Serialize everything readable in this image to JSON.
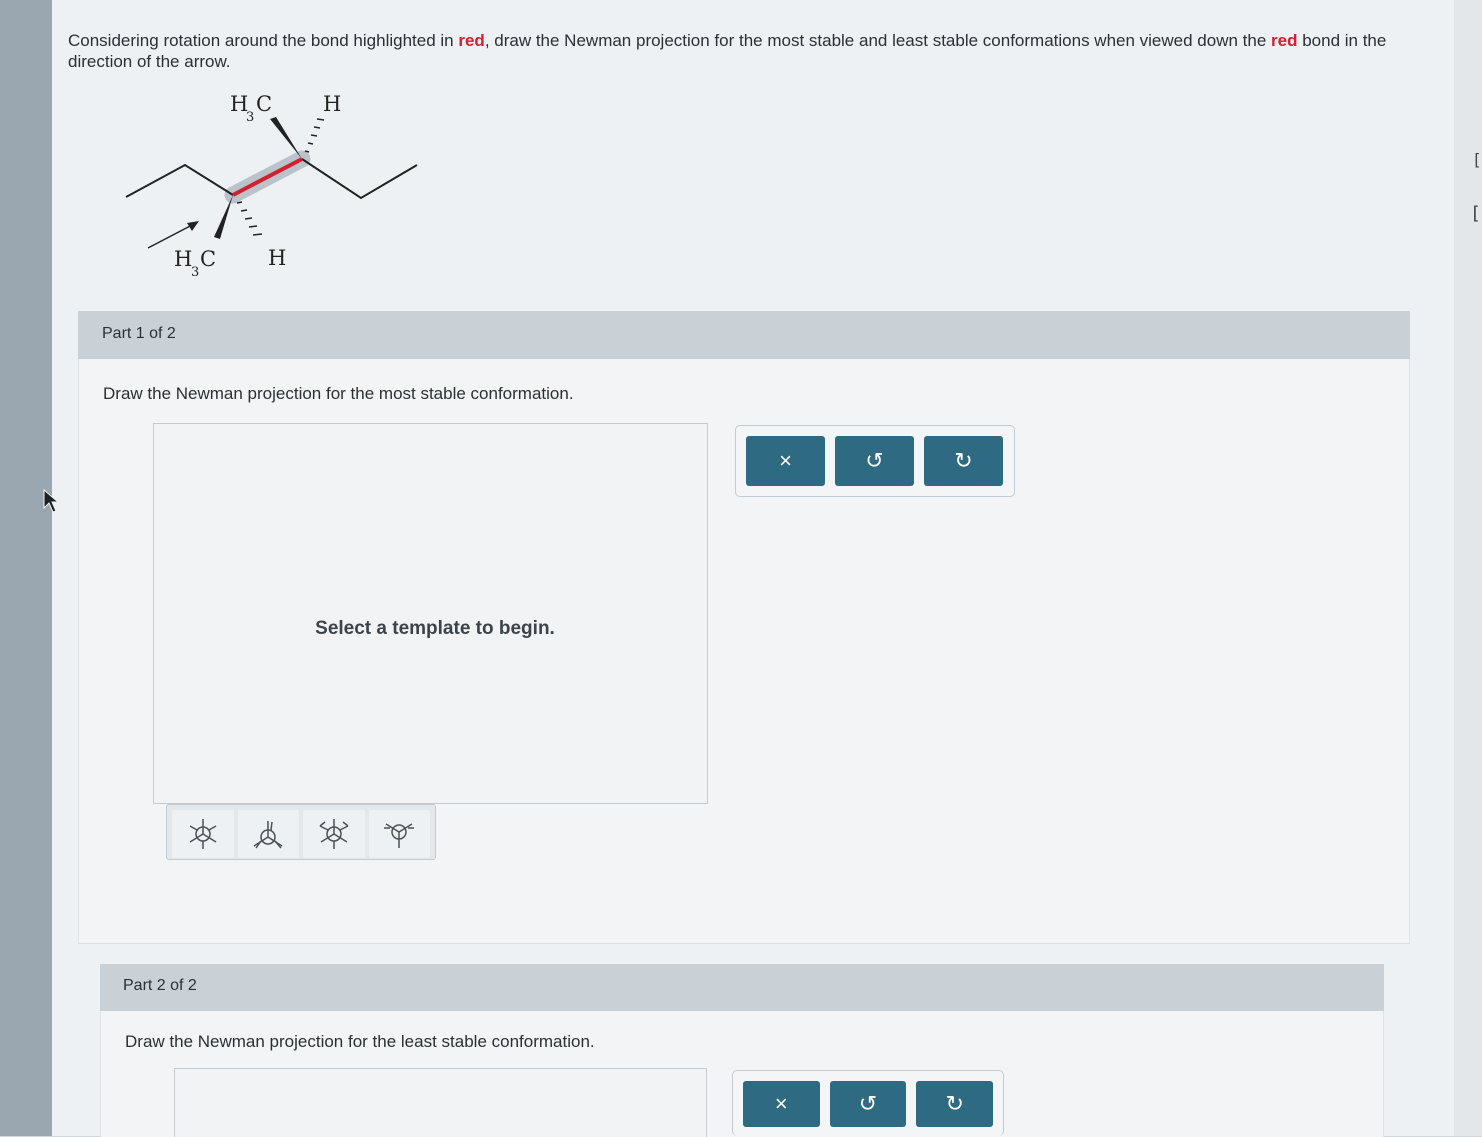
{
  "question": {
    "part1": "Considering rotation around the bond highlighted in ",
    "red1": "red",
    "part2": ", draw the Newman projection for the most stable and least stable conformations when viewed down the ",
    "red2": "red",
    "part3": " bond in the direction of the arrow."
  },
  "molecule": {
    "top_left_label": "H",
    "top_left_sub": "3",
    "top_left_tail": "C",
    "top_right_label": "H",
    "bottom_left_label": "H",
    "bottom_left_sub": "3",
    "bottom_left_tail": "C",
    "bottom_right_label": "H",
    "highlight_color": "#d1202f"
  },
  "part1": {
    "title": "Part 1 of 2",
    "instruction": "Draw the Newman projection for the most stable conformation.",
    "placeholder": "Select a template to begin.",
    "templates": [
      "newman-staggered-icon",
      "newman-eclipsed-icon",
      "newman-staggered-alt-icon",
      "newman-eclipsed-alt-icon"
    ],
    "toolbar": {
      "clear": "×",
      "undo": "↺",
      "redo": "↻"
    }
  },
  "part2": {
    "title": "Part 2 of 2",
    "instruction": "Draw the Newman projection for the least stable conformation.",
    "toolbar": {
      "clear": "×",
      "undo": "↺",
      "redo": "↻"
    }
  },
  "colors": {
    "button": "#2e6b82",
    "header": "#c9d1d7"
  }
}
